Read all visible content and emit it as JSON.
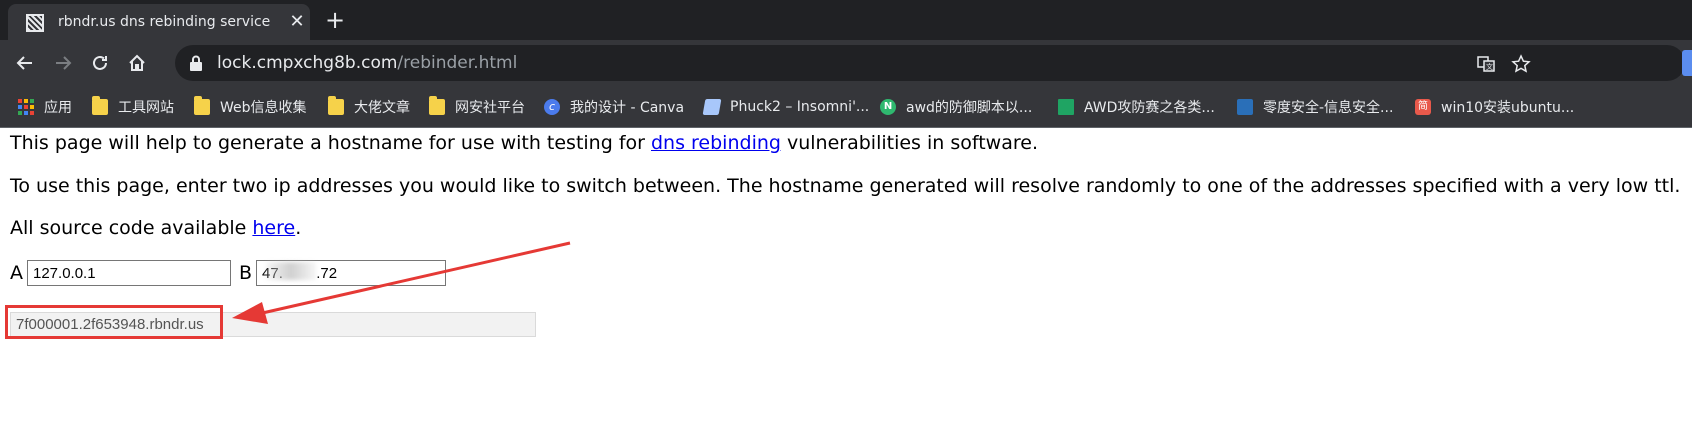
{
  "tab": {
    "title": "rbndr.us dns rebinding service",
    "close_icon": "close-icon",
    "new_tab_icon": "plus-icon"
  },
  "toolbar": {
    "url_host": "lock.cmpxchg8b.com",
    "url_path": "/rebinder.html"
  },
  "bookmarks": [
    {
      "label": "应用",
      "icon": "apps-grid-icon"
    },
    {
      "label": "工具网站",
      "icon": "folder-icon"
    },
    {
      "label": "Web信息收集",
      "icon": "folder-icon"
    },
    {
      "label": "大佬文章",
      "icon": "folder-icon"
    },
    {
      "label": "网安社平台",
      "icon": "folder-icon"
    },
    {
      "label": "我的设计 - Canva",
      "icon": "canva-icon"
    },
    {
      "label": "Phuck2 – Insomni'...",
      "icon": "document-icon"
    },
    {
      "label": "awd的防御脚本以...",
      "icon": "n-circle-icon"
    },
    {
      "label": "AWD攻防赛之各类...",
      "icon": "awd-icon"
    },
    {
      "label": "零度安全-信息安全...",
      "icon": "zero-security-icon"
    },
    {
      "label": "win10安装ubuntu...",
      "icon": "jianshu-icon"
    }
  ],
  "page": {
    "intro_before": "This page will help to generate a hostname for use with testing for ",
    "intro_link": "dns rebinding",
    "intro_after": " vulnerabilities in software.",
    "usage": "To use this page, enter two ip addresses you would like to switch between. The hostname generated will resolve randomly to one of the addresses specified with a very low ttl.",
    "source_before": "All source code available ",
    "source_link": "here",
    "source_after": ".",
    "label_a": "A",
    "value_a": "127.0.0.1",
    "label_b": "B",
    "value_b": "47.        .72",
    "result": "7f000001.2f653948.rbndr.us"
  },
  "colors": {
    "annotation": "#e53935",
    "link": "#0000ee"
  }
}
